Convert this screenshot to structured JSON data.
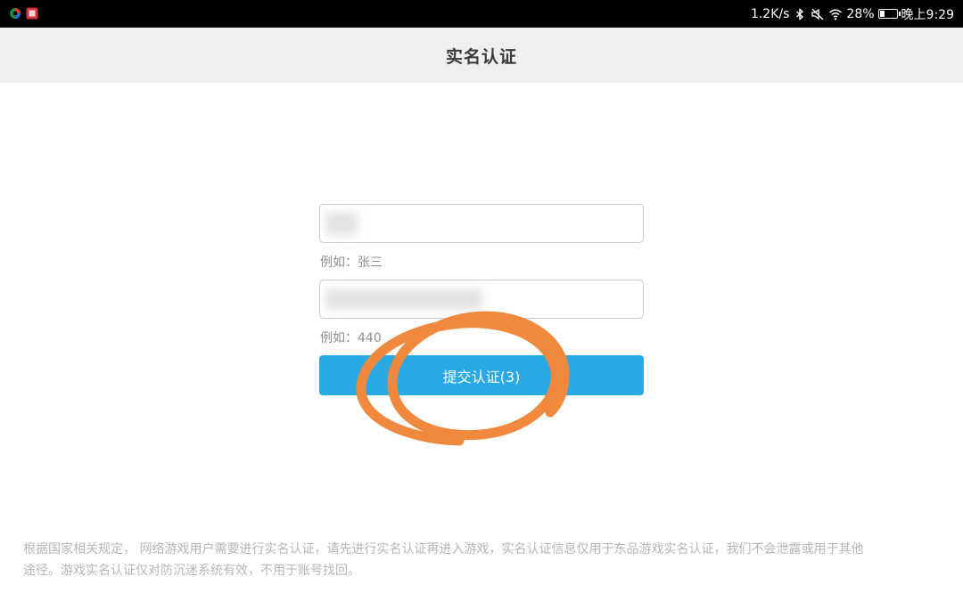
{
  "status_bar": {
    "speed": "1.2K/s",
    "battery_percent": "28%",
    "battery_level": 0.28,
    "time": "晚上9:29",
    "icons": [
      "app-icon-1",
      "app-icon-2",
      "bluetooth-icon",
      "mute-icon",
      "wifi-icon",
      "battery-icon"
    ]
  },
  "header": {
    "title": "实名认证"
  },
  "form": {
    "name_hint": "例如：张三",
    "id_hint": "例如：440",
    "submit_label": "提交认证(3)"
  },
  "notice": {
    "line1": "根据国家相关规定，  网络游戏用户需要进行实名认证，请先进行实名认证再进入游戏，实名认证信息仅用于东品游戏实名认证，我们不会泄露或用于其他",
    "line2": "途径。游戏实名认证仅对防沉迷系统有效，不用于账号找回。"
  },
  "colors": {
    "accent": "#29a9e6",
    "annotation": "#f0883e"
  }
}
